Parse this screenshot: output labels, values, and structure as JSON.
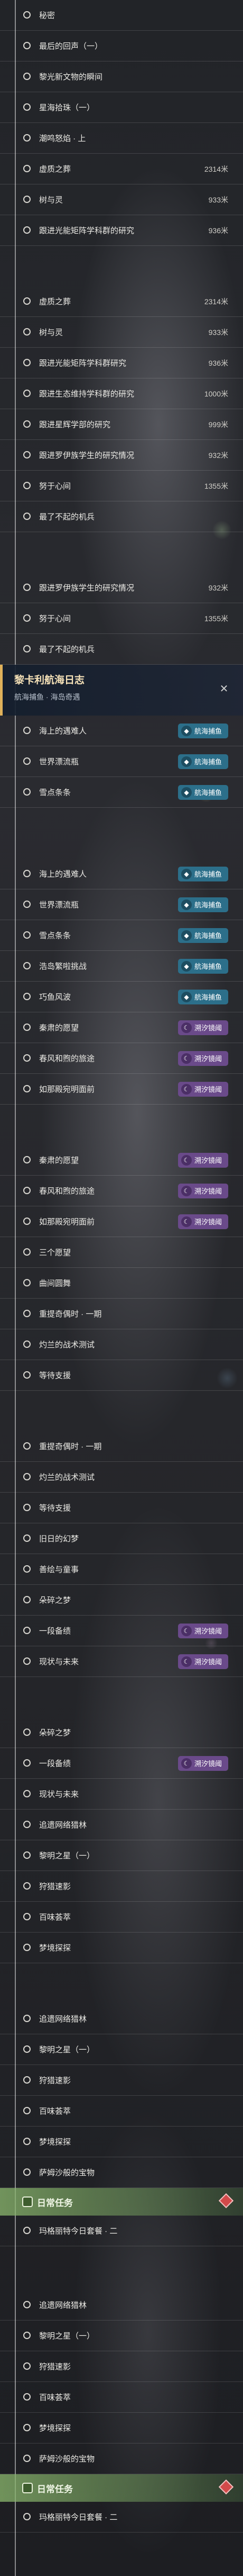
{
  "tags": {
    "sea": "航海捕鱼",
    "moon": "溯汐镜阈"
  },
  "screen1": {
    "rows": [
      {
        "label": "秘密",
        "val": "",
        "dot": "hollow"
      },
      {
        "label": "最后的回声（一）",
        "val": "",
        "dot": "hollow"
      },
      {
        "label": "黎光新文物的瞬间",
        "val": "",
        "dot": "hollow"
      },
      {
        "label": "星海拾珠（一）",
        "val": "",
        "dot": "hollow"
      },
      {
        "label": "潮鸣怒焰 · 上",
        "val": "",
        "dot": "hollow"
      },
      {
        "label": "虚质之葬",
        "val": "2314米",
        "dot": "hollow"
      },
      {
        "label": "树与灵",
        "val": "933米",
        "dot": "hollow"
      },
      {
        "label": "跟进光能矩阵学科群的研究",
        "val": "936米",
        "dot": "hollow"
      }
    ]
  },
  "screen2": {
    "rows": [
      {
        "label": "虚质之葬",
        "val": "2314米",
        "dot": "hollow"
      },
      {
        "label": "树与灵",
        "val": "933米",
        "dot": "hollow"
      },
      {
        "label": "跟进光能矩阵学科群研究",
        "val": "936米",
        "dot": "hollow"
      },
      {
        "label": "跟进生态维持学科群的研究",
        "val": "1000米",
        "dot": "hollow"
      },
      {
        "label": "跟进星辉学部的研究",
        "val": "999米",
        "dot": "hollow"
      },
      {
        "label": "跟进罗伊族学生的研究情况",
        "val": "932米",
        "dot": "hollow"
      },
      {
        "label": "努于心间",
        "val": "1355米",
        "dot": "hollow"
      },
      {
        "label": "最了不起的机兵",
        "val": "",
        "dot": "hollow"
      }
    ]
  },
  "screen3": {
    "rows": [
      {
        "label": "跟进罗伊族学生的研究情况",
        "val": "932米",
        "dot": "hollow"
      },
      {
        "label": "努于心间",
        "val": "1355米",
        "dot": "hollow"
      },
      {
        "label": "最了不起的机兵",
        "val": "",
        "dot": "hollow"
      }
    ],
    "panel": {
      "title": "黎卡利航海日志",
      "sub": "航海捕鱼 · 海岛奇遇",
      "close": "✕"
    },
    "tagged": [
      {
        "label": "海上的遇难人",
        "tag": "sea",
        "dot": "hollow"
      },
      {
        "label": "世界漂流瓶",
        "tag": "sea",
        "dot": "hollow"
      },
      {
        "label": "雪点条条",
        "tag": "sea",
        "dot": "hollow"
      }
    ]
  },
  "screen4": {
    "tagged": [
      {
        "label": "海上的遇难人",
        "tag": "sea",
        "dot": "hollow"
      },
      {
        "label": "世界漂流瓶",
        "tag": "sea",
        "dot": "hollow"
      },
      {
        "label": "雪点条条",
        "tag": "sea",
        "dot": "hollow"
      },
      {
        "label": "浩岛繁啦挑战",
        "tag": "sea",
        "dot": "hollow"
      },
      {
        "label": "巧鱼风波",
        "tag": "sea",
        "dot": "hollow"
      },
      {
        "label": "秦肃的愿望",
        "tag": "moon",
        "dot": "hollow"
      },
      {
        "label": "春风和煦的旅途",
        "tag": "moon",
        "dot": "hollow"
      },
      {
        "label": "如那殿宛明面前",
        "tag": "moon",
        "dot": "hollow"
      }
    ]
  },
  "screen5": {
    "rows": [
      {
        "label": "秦肃的愿望",
        "tag": "moon",
        "dot": "hollow"
      },
      {
        "label": "春风和煦的旅途",
        "tag": "moon",
        "dot": "hollow"
      },
      {
        "label": "如那殿宛明面前",
        "tag": "moon",
        "dot": "hollow"
      },
      {
        "label": "三个愿望",
        "tag": "",
        "dot": "hollow"
      },
      {
        "label": "曲间圆舞",
        "tag": "",
        "dot": "hollow"
      },
      {
        "label": "重提奇偶时 · 一期",
        "tag": "",
        "dot": "hollow"
      },
      {
        "label": "灼兰的战术测试",
        "tag": "",
        "dot": "hollow"
      },
      {
        "label": "等待支援",
        "tag": "",
        "dot": "hollow"
      }
    ]
  },
  "screen6": {
    "rows": [
      {
        "label": "重提奇偶时 · 一期",
        "tag": "",
        "dot": "hollow"
      },
      {
        "label": "灼兰的战术测试",
        "tag": "",
        "dot": "hollow"
      },
      {
        "label": "等待支援",
        "tag": "",
        "dot": "hollow"
      },
      {
        "label": "旧日的幻梦",
        "tag": "",
        "dot": "hollow"
      },
      {
        "label": "善绘与童事",
        "tag": "",
        "dot": "hollow"
      },
      {
        "label": "朵碎之梦",
        "tag": "",
        "dot": "hollow"
      },
      {
        "label": "一段备绩",
        "tag": "moon",
        "dot": "hollow"
      },
      {
        "label": "现状与未来",
        "tag": "moon",
        "dot": "hollow"
      }
    ]
  },
  "screen7": {
    "rows": [
      {
        "label": "朵碎之梦",
        "tag": "",
        "dot": "hollow"
      },
      {
        "label": "一段备绩",
        "tag": "moon",
        "dot": "hollow"
      },
      {
        "label": "现状与未来",
        "tag": "",
        "dot": "hollow"
      },
      {
        "label": "追遗网络猎林",
        "tag": "",
        "dot": "hollow"
      },
      {
        "label": "黎明之星（一）",
        "tag": "",
        "dot": "hollow"
      },
      {
        "label": "狩猎速影",
        "tag": "",
        "dot": "hollow"
      },
      {
        "label": "百味荟萃",
        "tag": "",
        "dot": "hollow"
      },
      {
        "label": "梦境探探",
        "tag": "",
        "dot": "hollow"
      }
    ]
  },
  "screen8": {
    "rows": [
      {
        "label": "追遗网络猎林",
        "tag": "",
        "dot": "hollow"
      },
      {
        "label": "黎明之星（一）",
        "tag": "",
        "dot": "hollow"
      },
      {
        "label": "狩猎速影",
        "tag": "",
        "dot": "hollow"
      },
      {
        "label": "百味荟萃",
        "tag": "",
        "dot": "hollow"
      },
      {
        "label": "梦境探探",
        "tag": "",
        "dot": "hollow"
      },
      {
        "label": "萨姆沙般的宝物",
        "tag": "",
        "dot": "hollow"
      }
    ],
    "task": {
      "title": "日常任务"
    },
    "task_rows": [
      {
        "label": "玛格丽特今日套餐 · 二",
        "dot": "hollow"
      }
    ]
  },
  "screen9": {
    "rows": [
      {
        "label": "追遗网络猎林",
        "tag": "",
        "dot": "hollow"
      },
      {
        "label": "黎明之星（一）",
        "tag": "",
        "dot": "hollow"
      },
      {
        "label": "狩猎速影",
        "tag": "",
        "dot": "hollow"
      },
      {
        "label": "百味荟萃",
        "tag": "",
        "dot": "hollow"
      },
      {
        "label": "梦境探探",
        "tag": "",
        "dot": "hollow"
      },
      {
        "label": "萨姆沙般的宝物",
        "tag": "",
        "dot": "hollow"
      }
    ],
    "task": {
      "title": "日常任务"
    },
    "task_rows": [
      {
        "label": "玛格丽特今日套餐 · 二",
        "dot": "hollow"
      }
    ]
  }
}
